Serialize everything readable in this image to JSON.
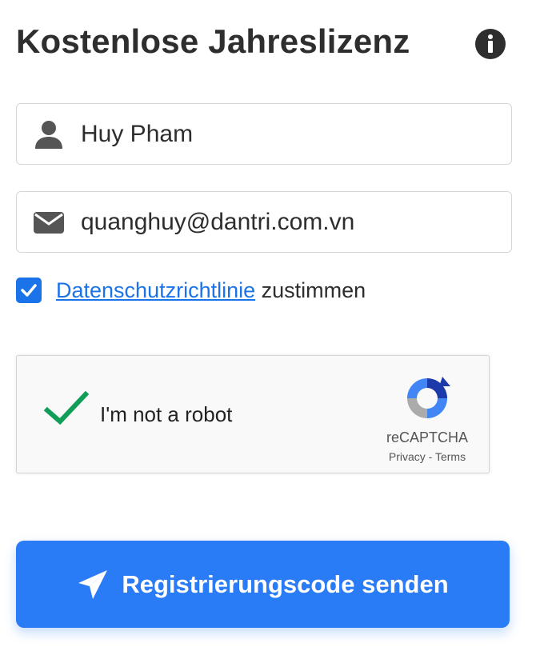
{
  "form": {
    "title": "Kostenlose Jahreslizenz",
    "name_value": "Huy Pham",
    "email_value": "quanghuy@dantri.com.vn",
    "privacy_link": "Datenschutzrichtlinie",
    "privacy_suffix": " zustimmen",
    "privacy_checked": true,
    "submit_label": "Registrierungscode senden"
  },
  "recaptcha": {
    "label": "I'm not a robot",
    "brand": "reCAPTCHA",
    "privacy": "Privacy",
    "separator": " - ",
    "terms": "Terms",
    "checked": true
  },
  "icons": {
    "info": "info-icon",
    "user": "user-icon",
    "email": "envelope-icon",
    "checkbox": "checkbox-checked-icon",
    "check": "green-check-icon",
    "recaptcha": "recaptcha-logo-icon",
    "send": "paper-plane-icon"
  },
  "colors": {
    "accent": "#2a7bf6",
    "checkbox": "#1a73e8",
    "link": "#1a73e8",
    "check_green": "#0f9d58",
    "icon_gray": "#555555"
  }
}
